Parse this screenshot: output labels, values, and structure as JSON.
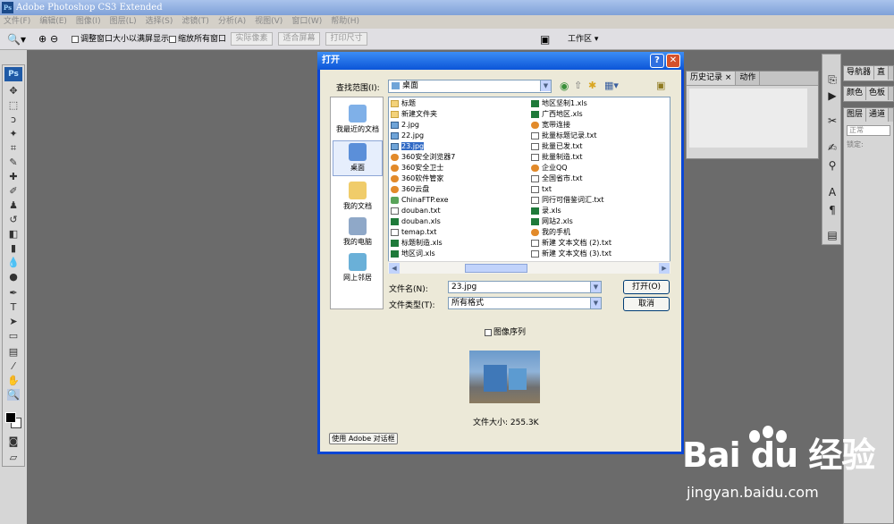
{
  "app": {
    "title": "Adobe Photoshop CS3 Extended",
    "logo": "Ps",
    "menu": [
      "文件(F)",
      "编辑(E)",
      "图像(I)",
      "图层(L)",
      "选择(S)",
      "滤镜(T)",
      "分析(A)",
      "视图(V)",
      "窗口(W)",
      "帮助(H)"
    ]
  },
  "options_bar": {
    "resize_windows": "调整窗口大小以满屏显示",
    "zoom_all": "缩放所有窗口",
    "actual_pixels": "实际像素",
    "fit_screen": "适合屏幕",
    "print_size": "打印尺寸",
    "workspace": "工作区"
  },
  "history_panel": {
    "tabs": [
      "历史记录",
      "动作"
    ]
  },
  "right_panels": {
    "row1": [
      "导航器",
      "直"
    ],
    "row2": [
      "颜色",
      "色板"
    ],
    "row3": [
      "图层",
      "通道"
    ],
    "blend_mode": "正常",
    "lock_label": "锁定:"
  },
  "dialog": {
    "title": "打开",
    "look_in_label": "查找范围(I):",
    "look_in_value": "桌面",
    "places": [
      "我最近的文档",
      "桌面",
      "我的文档",
      "我的电脑",
      "网上邻居"
    ],
    "files_col1": [
      {
        "name": "标题",
        "type": "folder"
      },
      {
        "name": "新建文件夹",
        "type": "folder"
      },
      {
        "name": "2.jpg",
        "type": "img"
      },
      {
        "name": "22.jpg",
        "type": "img"
      },
      {
        "name": "23.jpg",
        "type": "img",
        "selected": true
      },
      {
        "name": "360安全浏览器7",
        "type": "app"
      },
      {
        "name": "360安全卫士",
        "type": "app"
      },
      {
        "name": "360软件管家",
        "type": "app"
      },
      {
        "name": "360云盘",
        "type": "app"
      },
      {
        "name": "ChinaFTP.exe",
        "type": "exe"
      },
      {
        "name": "douban.txt",
        "type": "txt"
      },
      {
        "name": "douban.xls",
        "type": "xls"
      },
      {
        "name": "temap.txt",
        "type": "txt"
      },
      {
        "name": "标题制造.xls",
        "type": "xls"
      },
      {
        "name": "地区词.xls",
        "type": "xls"
      }
    ],
    "files_col2": [
      {
        "name": "地区坚制1.xls",
        "type": "xls"
      },
      {
        "name": "广西地区.xls",
        "type": "xls"
      },
      {
        "name": "宽带连接",
        "type": "app"
      },
      {
        "name": "批量标题记录.txt",
        "type": "txt"
      },
      {
        "name": "批量已发.txt",
        "type": "txt"
      },
      {
        "name": "批量制造.txt",
        "type": "txt"
      },
      {
        "name": "企业QQ",
        "type": "app"
      },
      {
        "name": "全国省市.txt",
        "type": "txt"
      },
      {
        "name": "txt",
        "type": "txt"
      },
      {
        "name": "同行可借鉴词汇.txt",
        "type": "txt"
      },
      {
        "name": "录.xls",
        "type": "xls"
      },
      {
        "name": "网站2.xls",
        "type": "xls"
      },
      {
        "name": "我的手机",
        "type": "app"
      },
      {
        "name": "新建 文本文档 (2).txt",
        "type": "txt"
      },
      {
        "name": "新建 文本文档 (3).txt",
        "type": "txt"
      }
    ],
    "filename_label": "文件名(N):",
    "filename_value": "23.jpg",
    "filetype_label": "文件类型(T):",
    "filetype_value": "所有格式",
    "open_button": "打开(O)",
    "cancel_button": "取消",
    "image_sequence": "图像序列",
    "file_size": "文件大小: 255.3K",
    "adobe_dialog_button": "使用 Adobe 对话框"
  },
  "watermark": {
    "brand": "Bai du 经验",
    "url": "jingyan.baidu.com"
  }
}
